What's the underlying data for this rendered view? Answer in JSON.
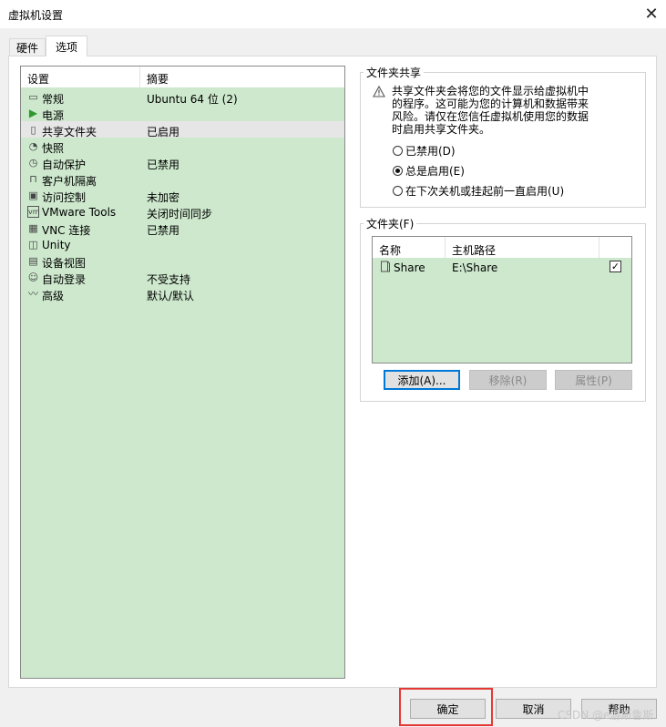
{
  "window": {
    "title": "虚拟机设置",
    "close_glyph": "✕"
  },
  "tabs": [
    {
      "label": "硬件"
    },
    {
      "label": "选项"
    }
  ],
  "settings_list": {
    "headers": {
      "setting": "设置",
      "summary": "摘要"
    },
    "rows": [
      {
        "icon": "monitor-icon",
        "glyph": "▭",
        "name": "常规",
        "summary": "Ubuntu 64 位 (2)"
      },
      {
        "icon": "power-play-icon",
        "glyph": "▶",
        "name": "电源",
        "summary": ""
      },
      {
        "icon": "shared-folder-icon",
        "glyph": "▯",
        "name": "共享文件夹",
        "summary": "已启用"
      },
      {
        "icon": "snapshot-icon",
        "glyph": "◔",
        "name": "快照",
        "summary": ""
      },
      {
        "icon": "autoprotect-clock-icon",
        "glyph": "◷",
        "name": "自动保护",
        "summary": "已禁用"
      },
      {
        "icon": "lock-icon",
        "glyph": "⊓",
        "name": "客户机隔离",
        "summary": ""
      },
      {
        "icon": "access-control-icon",
        "glyph": "▣",
        "name": "访问控制",
        "summary": "未加密"
      },
      {
        "icon": "vmware-tools-icon",
        "glyph": "vm",
        "name": "VMware Tools",
        "summary": "关闭时间同步"
      },
      {
        "icon": "vnc-icon",
        "glyph": "▦",
        "name": "VNC 连接",
        "summary": "已禁用"
      },
      {
        "icon": "unity-icon",
        "glyph": "◫",
        "name": "Unity",
        "summary": ""
      },
      {
        "icon": "device-view-icon",
        "glyph": "▤",
        "name": "设备视图",
        "summary": ""
      },
      {
        "icon": "autologin-user-icon",
        "glyph": "☺",
        "name": "自动登录",
        "summary": "不受支持"
      },
      {
        "icon": "advanced-graph-icon",
        "glyph": "〰",
        "name": "高级",
        "summary": "默认/默认"
      }
    ],
    "selected_index": 2
  },
  "folder_sharing": {
    "title": "文件夹共享",
    "warning_icon": "warning-triangle-icon",
    "warning_lines": [
      "共享文件夹会将您的文件显示给虚拟机中",
      "的程序。这可能为您的计算机和数据带来",
      "风险。请仅在您信任虚拟机使用您的数据",
      "时启用共享文件夹。"
    ],
    "options": [
      {
        "label": "已禁用(D)",
        "selected": false
      },
      {
        "label": "总是启用(E)",
        "selected": true
      },
      {
        "label": "在下次关机或挂起前一直启用(U)",
        "selected": false
      }
    ]
  },
  "folders": {
    "title": "文件夹(F)",
    "headers": {
      "name": "名称",
      "host_path": "主机路径"
    },
    "rows": [
      {
        "icon": "folder-share-icon",
        "name": "Share",
        "path": "E:\\Share",
        "enabled": true
      }
    ],
    "buttons": {
      "add": "添加(A)...",
      "remove": "移除(R)",
      "properties": "属性(P)"
    }
  },
  "dialog_buttons": {
    "ok": "确定",
    "cancel": "取消",
    "help": "帮助"
  },
  "watermark": "CSDN @e游斯鲁斯"
}
